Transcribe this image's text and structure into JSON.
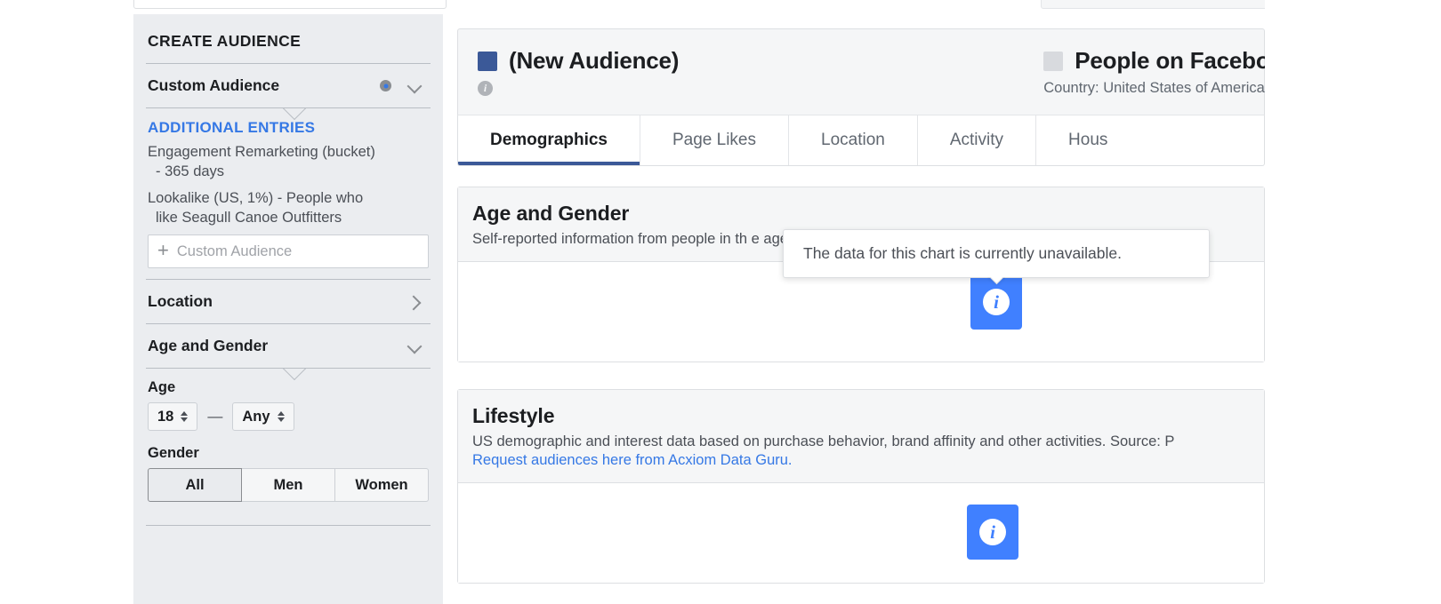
{
  "sidebar": {
    "heading": "CREATE AUDIENCE",
    "custom_audience": {
      "label": "Custom Audience"
    },
    "additional_entries": {
      "title": "ADDITIONAL ENTRIES",
      "items": [
        {
          "line1": "Engagement Remarketing (bucket)",
          "line2": "- 365 days"
        },
        {
          "line1": "Lookalike (US, 1%) - People who",
          "line2": "like Seagull Canoe Outfitters"
        }
      ],
      "input_placeholder": "Custom Audience",
      "plus": "+"
    },
    "location": {
      "label": "Location"
    },
    "age_and_gender": {
      "label": "Age and Gender",
      "age_label": "Age",
      "age_min": "18",
      "age_max": "Any",
      "dash": "—",
      "gender_label": "Gender",
      "gender_options": [
        "All",
        "Men",
        "Women"
      ],
      "gender_selected": "All"
    }
  },
  "main": {
    "header": {
      "audience_name": "(New Audience)",
      "audience_swatch": "#3b5998",
      "compare_name": "People on Faceboo",
      "compare_swatch": "#d8dade",
      "compare_sub": "Country: United States of America"
    },
    "tabs": [
      {
        "label": "Demographics",
        "active": true
      },
      {
        "label": "Page Likes",
        "active": false
      },
      {
        "label": "Location",
        "active": false
      },
      {
        "label": "Activity",
        "active": false
      },
      {
        "label": "Hous",
        "active": false
      }
    ],
    "sections": [
      {
        "title": "Age and Gender",
        "desc": "Self-reported information from people in th                                            e aged 1",
        "link": ""
      },
      {
        "title": "Lifestyle",
        "desc": "US demographic and interest data based on purchase behavior, brand affinity and other activities. Source: P",
        "link": "Request audiences here from Acxiom Data Guru."
      }
    ],
    "tooltip": {
      "text": "The data for this chart is currently unavailable."
    },
    "info_button": {
      "glyph": "i"
    }
  },
  "colors": {
    "accent_blue": "#3578e5",
    "info_blue": "#4080ff",
    "tab_underline": "#3b5998",
    "sidebar_bg": "#ebedf0"
  }
}
